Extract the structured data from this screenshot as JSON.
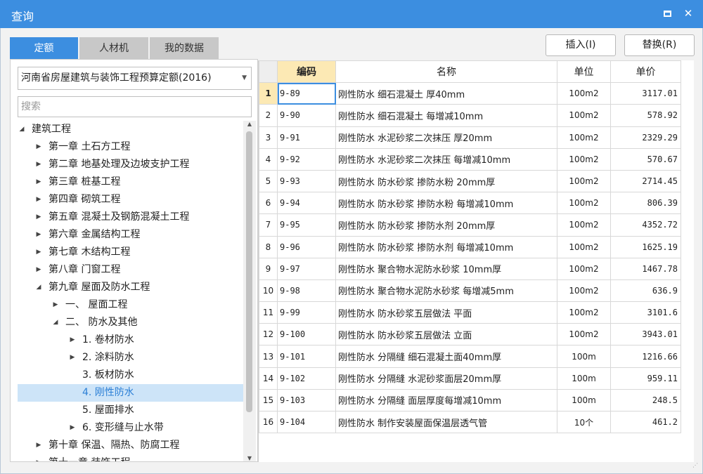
{
  "window": {
    "title": "查询",
    "maximize_icon": "maximize-icon",
    "close_label": "✕"
  },
  "tabs": [
    {
      "label": "定额",
      "active": true
    },
    {
      "label": "人材机",
      "active": false
    },
    {
      "label": "我的数据",
      "active": false
    }
  ],
  "actions": {
    "insert_label": "插入(I)",
    "replace_label": "替换(R)"
  },
  "library": {
    "selected": "河南省房屋建筑与装饰工程预算定额(2016)"
  },
  "search": {
    "placeholder": "搜索"
  },
  "tree": [
    {
      "label": "建筑工程",
      "level": 0,
      "arrow": "expanded"
    },
    {
      "label": "第一章 土石方工程",
      "level": 1,
      "arrow": "collapsed"
    },
    {
      "label": "第二章 地基处理及边坡支护工程",
      "level": 1,
      "arrow": "collapsed"
    },
    {
      "label": "第三章 桩基工程",
      "level": 1,
      "arrow": "collapsed"
    },
    {
      "label": "第四章 砌筑工程",
      "level": 1,
      "arrow": "collapsed"
    },
    {
      "label": "第五章 混凝土及钢筋混凝土工程",
      "level": 1,
      "arrow": "collapsed"
    },
    {
      "label": "第六章 金属结构工程",
      "level": 1,
      "arrow": "collapsed"
    },
    {
      "label": "第七章 木结构工程",
      "level": 1,
      "arrow": "collapsed"
    },
    {
      "label": "第八章 门窗工程",
      "level": 1,
      "arrow": "collapsed"
    },
    {
      "label": "第九章 屋面及防水工程",
      "level": 1,
      "arrow": "expanded"
    },
    {
      "label": "一、 屋面工程",
      "level": 2,
      "arrow": "collapsed"
    },
    {
      "label": "二、 防水及其他",
      "level": 2,
      "arrow": "expanded"
    },
    {
      "label": "1. 卷材防水",
      "level": 3,
      "arrow": "collapsed"
    },
    {
      "label": "2. 涂料防水",
      "level": 3,
      "arrow": "collapsed"
    },
    {
      "label": "3. 板材防水",
      "level": 3,
      "arrow": "none"
    },
    {
      "label": "4. 刚性防水",
      "level": 3,
      "arrow": "none",
      "selected": true
    },
    {
      "label": "5. 屋面排水",
      "level": 3,
      "arrow": "none"
    },
    {
      "label": "6. 变形缝与止水带",
      "level": 3,
      "arrow": "collapsed"
    },
    {
      "label": "第十章 保温、隔热、防腐工程",
      "level": 1,
      "arrow": "collapsed"
    },
    {
      "label": "第十一章 装饰工程",
      "level": 1,
      "arrow": "collapsed"
    }
  ],
  "grid": {
    "headers": {
      "code": "编码",
      "name": "名称",
      "unit": "单位",
      "price": "单价"
    },
    "rows": [
      {
        "num": "1",
        "code": "9-89",
        "name": "刚性防水 细石混凝土 厚40mm",
        "unit": "100m2",
        "price": "3117.01"
      },
      {
        "num": "2",
        "code": "9-90",
        "name": "刚性防水 细石混凝土 每增减10mm",
        "unit": "100m2",
        "price": "578.92"
      },
      {
        "num": "3",
        "code": "9-91",
        "name": "刚性防水 水泥砂浆二次抹压 厚20mm",
        "unit": "100m2",
        "price": "2329.29"
      },
      {
        "num": "4",
        "code": "9-92",
        "name": "刚性防水 水泥砂浆二次抹压 每增减10mm",
        "unit": "100m2",
        "price": "570.67"
      },
      {
        "num": "5",
        "code": "9-93",
        "name": "刚性防水 防水砂浆 掺防水粉 20mm厚",
        "unit": "100m2",
        "price": "2714.45"
      },
      {
        "num": "6",
        "code": "9-94",
        "name": "刚性防水 防水砂浆 掺防水粉 每增减10mm",
        "unit": "100m2",
        "price": "806.39"
      },
      {
        "num": "7",
        "code": "9-95",
        "name": "刚性防水 防水砂浆 掺防水剂 20mm厚",
        "unit": "100m2",
        "price": "4352.72"
      },
      {
        "num": "8",
        "code": "9-96",
        "name": "刚性防水 防水砂浆 掺防水剂 每增减10mm",
        "unit": "100m2",
        "price": "1625.19"
      },
      {
        "num": "9",
        "code": "9-97",
        "name": "刚性防水 聚合物水泥防水砂浆 10mm厚",
        "unit": "100m2",
        "price": "1467.78"
      },
      {
        "num": "10",
        "code": "9-98",
        "name": "刚性防水 聚合物水泥防水砂浆 每增减5mm",
        "unit": "100m2",
        "price": "636.9"
      },
      {
        "num": "11",
        "code": "9-99",
        "name": "刚性防水 防水砂浆五层做法 平面",
        "unit": "100m2",
        "price": "3101.6"
      },
      {
        "num": "12",
        "code": "9-100",
        "name": "刚性防水 防水砂浆五层做法 立面",
        "unit": "100m2",
        "price": "3943.01"
      },
      {
        "num": "13",
        "code": "9-101",
        "name": "刚性防水 分隔缝 细石混凝土面40mm厚",
        "unit": "100m",
        "price": "1216.66"
      },
      {
        "num": "14",
        "code": "9-102",
        "name": "刚性防水 分隔缝 水泥砂浆面层20mm厚",
        "unit": "100m",
        "price": "959.11"
      },
      {
        "num": "15",
        "code": "9-103",
        "name": "刚性防水 分隔缝 面层厚度每增减10mm",
        "unit": "100m",
        "price": "248.5"
      },
      {
        "num": "16",
        "code": "9-104",
        "name": "刚性防水 制作安装屋面保温层透气管",
        "unit": "10个",
        "price": "461.2"
      }
    ]
  },
  "colors": {
    "titlebar": "#3c8ee0",
    "active_tab": "#3c8ee0",
    "header_highlight": "#fce9b4",
    "selected_tree_row": "#cde4f8",
    "selected_tree_text": "#2b7fd6"
  }
}
